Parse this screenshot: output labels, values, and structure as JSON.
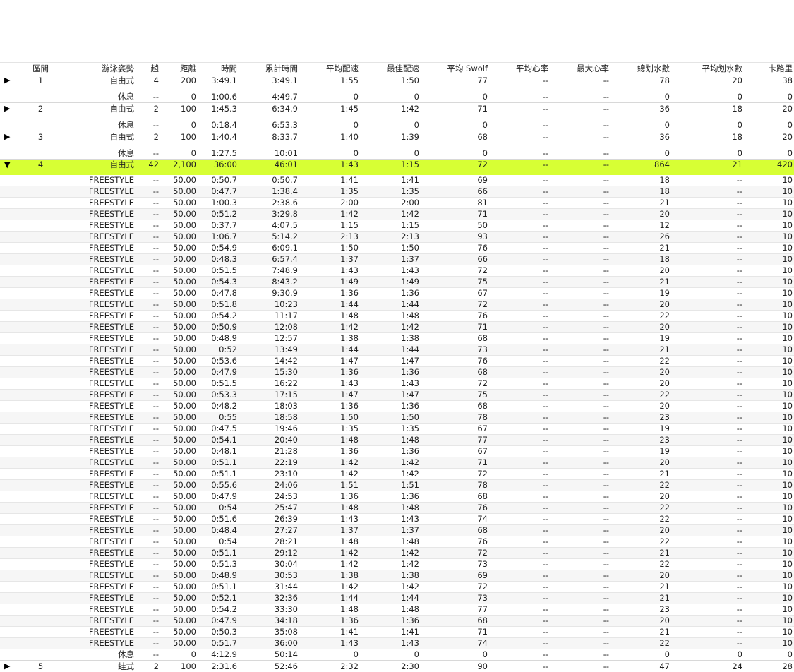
{
  "headers": [
    "區間",
    "游泳姿勢",
    "趟",
    "距離",
    "時間",
    "累計時間",
    "平均配速",
    "最佳配速",
    "平均 Swolf",
    "平均心率",
    "最大心率",
    "總划水數",
    "平均划水數",
    "卡路里"
  ],
  "laps": [
    {
      "lap": "1",
      "stroke": "自由式",
      "lengths": "4",
      "dist": "200",
      "time": "3:49.1",
      "cum": "3:49.1",
      "avg": "1:55",
      "best": "1:50",
      "swolf": "77",
      "hr": "--",
      "maxhr": "--",
      "strokes": "78",
      "avgs": "20",
      "cal": "38",
      "rest": {
        "label": "休息",
        "lengths": "--",
        "dist": "0",
        "time": "1:00.6",
        "cum": "4:49.7",
        "avg": "0",
        "best": "0",
        "swolf": "0",
        "hr": "--",
        "maxhr": "--",
        "strokes": "0",
        "avgs": "0",
        "cal": "0"
      }
    },
    {
      "lap": "2",
      "stroke": "自由式",
      "lengths": "2",
      "dist": "100",
      "time": "1:45.3",
      "cum": "6:34.9",
      "avg": "1:45",
      "best": "1:42",
      "swolf": "71",
      "hr": "--",
      "maxhr": "--",
      "strokes": "36",
      "avgs": "18",
      "cal": "20",
      "rest": {
        "label": "休息",
        "lengths": "--",
        "dist": "0",
        "time": "0:18.4",
        "cum": "6:53.3",
        "avg": "0",
        "best": "0",
        "swolf": "0",
        "hr": "--",
        "maxhr": "--",
        "strokes": "0",
        "avgs": "0",
        "cal": "0"
      }
    },
    {
      "lap": "3",
      "stroke": "自由式",
      "lengths": "2",
      "dist": "100",
      "time": "1:40.4",
      "cum": "8:33.7",
      "avg": "1:40",
      "best": "1:39",
      "swolf": "68",
      "hr": "--",
      "maxhr": "--",
      "strokes": "36",
      "avgs": "18",
      "cal": "20",
      "rest": {
        "label": "休息",
        "lengths": "--",
        "dist": "0",
        "time": "1:27.5",
        "cum": "10:01",
        "avg": "0",
        "best": "0",
        "swolf": "0",
        "hr": "--",
        "maxhr": "--",
        "strokes": "0",
        "avgs": "0",
        "cal": "0"
      }
    }
  ],
  "selected_lap": {
    "lap": "4",
    "stroke": "自由式",
    "lengths": "42",
    "dist": "2,100",
    "time": "36:00",
    "cum": "46:01",
    "avg": "1:43",
    "best": "1:15",
    "swolf": "72",
    "hr": "--",
    "maxhr": "--",
    "strokes": "864",
    "avgs": "21",
    "cal": "420",
    "highlight": "#d7ff34"
  },
  "length_stroke": "FREESTYLE",
  "length_rows": [
    [
      "0:50.7",
      "0:50.7",
      "1:41",
      "1:41",
      "69",
      "18"
    ],
    [
      "0:47.7",
      "1:38.4",
      "1:35",
      "1:35",
      "66",
      "18"
    ],
    [
      "1:00.3",
      "2:38.6",
      "2:00",
      "2:00",
      "81",
      "21"
    ],
    [
      "0:51.2",
      "3:29.8",
      "1:42",
      "1:42",
      "71",
      "20"
    ],
    [
      "0:37.7",
      "4:07.5",
      "1:15",
      "1:15",
      "50",
      "12"
    ],
    [
      "1:06.7",
      "5:14.2",
      "2:13",
      "2:13",
      "93",
      "26"
    ],
    [
      "0:54.9",
      "6:09.1",
      "1:50",
      "1:50",
      "76",
      "21"
    ],
    [
      "0:48.3",
      "6:57.4",
      "1:37",
      "1:37",
      "66",
      "18"
    ],
    [
      "0:51.5",
      "7:48.9",
      "1:43",
      "1:43",
      "72",
      "20"
    ],
    [
      "0:54.3",
      "8:43.2",
      "1:49",
      "1:49",
      "75",
      "21"
    ],
    [
      "0:47.8",
      "9:30.9",
      "1:36",
      "1:36",
      "67",
      "19"
    ],
    [
      "0:51.8",
      "10:23",
      "1:44",
      "1:44",
      "72",
      "20"
    ],
    [
      "0:54.2",
      "11:17",
      "1:48",
      "1:48",
      "76",
      "22"
    ],
    [
      "0:50.9",
      "12:08",
      "1:42",
      "1:42",
      "71",
      "20"
    ],
    [
      "0:48.9",
      "12:57",
      "1:38",
      "1:38",
      "68",
      "19"
    ],
    [
      "0:52",
      "13:49",
      "1:44",
      "1:44",
      "73",
      "21"
    ],
    [
      "0:53.6",
      "14:42",
      "1:47",
      "1:47",
      "76",
      "22"
    ],
    [
      "0:47.9",
      "15:30",
      "1:36",
      "1:36",
      "68",
      "20"
    ],
    [
      "0:51.5",
      "16:22",
      "1:43",
      "1:43",
      "72",
      "20"
    ],
    [
      "0:53.3",
      "17:15",
      "1:47",
      "1:47",
      "75",
      "22"
    ],
    [
      "0:48.2",
      "18:03",
      "1:36",
      "1:36",
      "68",
      "20"
    ],
    [
      "0:55",
      "18:58",
      "1:50",
      "1:50",
      "78",
      "23"
    ],
    [
      "0:47.5",
      "19:46",
      "1:35",
      "1:35",
      "67",
      "19"
    ],
    [
      "0:54.1",
      "20:40",
      "1:48",
      "1:48",
      "77",
      "23"
    ],
    [
      "0:48.1",
      "21:28",
      "1:36",
      "1:36",
      "67",
      "19"
    ],
    [
      "0:51.1",
      "22:19",
      "1:42",
      "1:42",
      "71",
      "20"
    ],
    [
      "0:51.1",
      "23:10",
      "1:42",
      "1:42",
      "72",
      "21"
    ],
    [
      "0:55.6",
      "24:06",
      "1:51",
      "1:51",
      "78",
      "22"
    ],
    [
      "0:47.9",
      "24:53",
      "1:36",
      "1:36",
      "68",
      "20"
    ],
    [
      "0:54",
      "25:47",
      "1:48",
      "1:48",
      "76",
      "22"
    ],
    [
      "0:51.6",
      "26:39",
      "1:43",
      "1:43",
      "74",
      "22"
    ],
    [
      "0:48.4",
      "27:27",
      "1:37",
      "1:37",
      "68",
      "20"
    ],
    [
      "0:54",
      "28:21",
      "1:48",
      "1:48",
      "76",
      "22"
    ],
    [
      "0:51.1",
      "29:12",
      "1:42",
      "1:42",
      "72",
      "21"
    ],
    [
      "0:51.3",
      "30:04",
      "1:42",
      "1:42",
      "73",
      "22"
    ],
    [
      "0:48.9",
      "30:53",
      "1:38",
      "1:38",
      "69",
      "20"
    ],
    [
      "0:51.1",
      "31:44",
      "1:42",
      "1:42",
      "72",
      "21"
    ],
    [
      "0:52.1",
      "32:36",
      "1:44",
      "1:44",
      "73",
      "21"
    ],
    [
      "0:54.2",
      "33:30",
      "1:48",
      "1:48",
      "77",
      "23"
    ],
    [
      "0:47.9",
      "34:18",
      "1:36",
      "1:36",
      "68",
      "20"
    ],
    [
      "0:50.3",
      "35:08",
      "1:41",
      "1:41",
      "71",
      "21"
    ],
    [
      "0:51.7",
      "36:00",
      "1:43",
      "1:43",
      "74",
      "22"
    ]
  ],
  "length_fixed": {
    "lengths": "--",
    "dist": "50.00",
    "hr": "--",
    "maxhr": "--",
    "avgs": "--",
    "cal": "10"
  },
  "final_rest": {
    "label": "休息",
    "lengths": "--",
    "dist": "0",
    "time": "4:12.9",
    "cum": "50:14",
    "avg": "0",
    "best": "0",
    "swolf": "0",
    "hr": "--",
    "maxhr": "--",
    "strokes": "0",
    "avgs": "0",
    "cal": "0"
  },
  "partial_lap": {
    "lap": "5",
    "stroke": "蛙式",
    "lengths": "2",
    "dist": "100",
    "time": "2:31.6",
    "cum": "52:46",
    "avg": "2:32",
    "best": "2:30",
    "swolf": "90",
    "hr": "--",
    "maxhr": "--",
    "strokes": "47",
    "avgs": "24",
    "cal": "28"
  }
}
